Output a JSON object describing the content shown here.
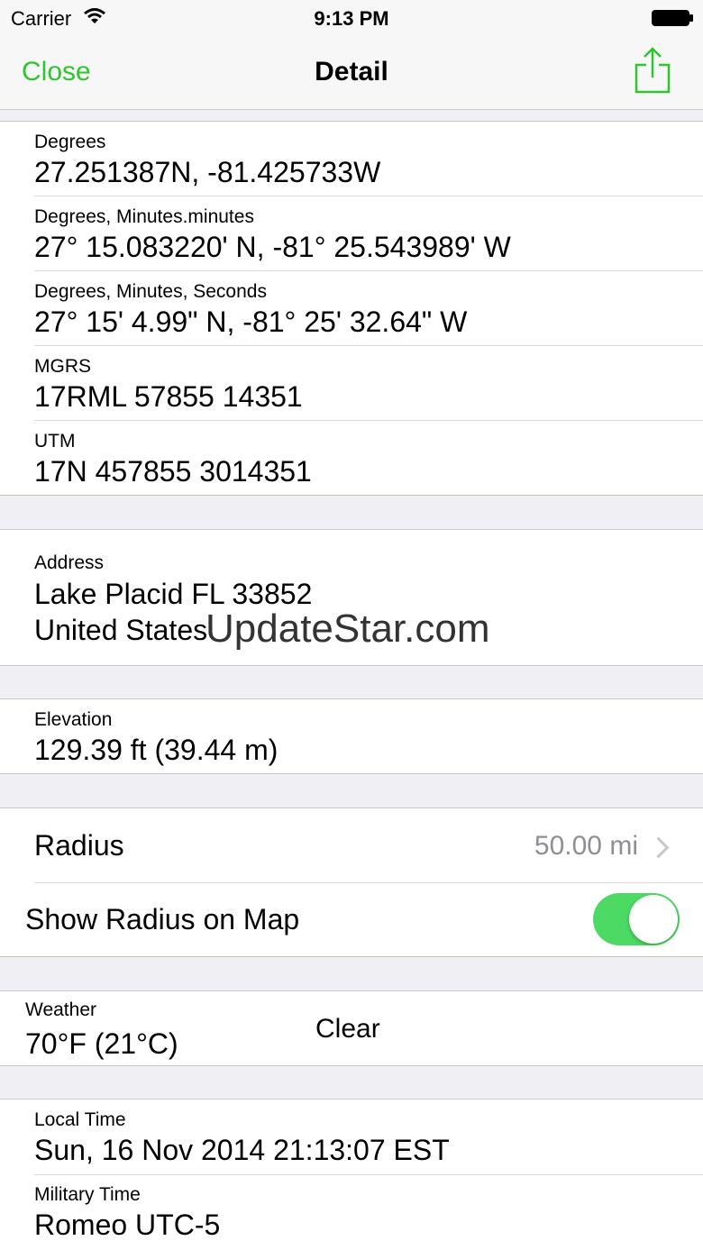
{
  "status_bar": {
    "carrier": "Carrier",
    "time": "9:13 PM"
  },
  "nav": {
    "close_label": "Close",
    "title": "Detail",
    "share_icon": "share-icon"
  },
  "coordinates": [
    {
      "label": "Degrees",
      "value": "27.251387N, -81.425733W"
    },
    {
      "label": "Degrees, Minutes.minutes",
      "value": "27° 15.083220' N, -81° 25.543989' W"
    },
    {
      "label": "Degrees, Minutes, Seconds",
      "value": "27° 15' 4.99\" N, -81° 25' 32.64\" W"
    },
    {
      "label": "MGRS",
      "value": "17RML 57855 14351"
    },
    {
      "label": "UTM",
      "value": "17N 457855 3014351"
    }
  ],
  "address": {
    "label": "Address",
    "line1": "Lake Placid FL 33852",
    "line2": "United States"
  },
  "watermark": "UpdateStar.com",
  "elevation": {
    "label": "Elevation",
    "value": "129.39 ft (39.44 m)"
  },
  "radius": {
    "label": "Radius",
    "value": "50.00 mi",
    "show_on_map_label": "Show Radius on Map",
    "show_on_map": true
  },
  "weather": {
    "label": "Weather",
    "temperature": "70°F (21°C)",
    "condition": "Clear"
  },
  "time": [
    {
      "label": "Local Time",
      "value": "Sun, 16 Nov 2014 21:13:07 EST"
    },
    {
      "label": "Military Time",
      "value": "Romeo UTC-5"
    }
  ],
  "colors": {
    "accent": "#2ec52e",
    "toggle_on": "#4cd964",
    "background": "#efeff4"
  }
}
